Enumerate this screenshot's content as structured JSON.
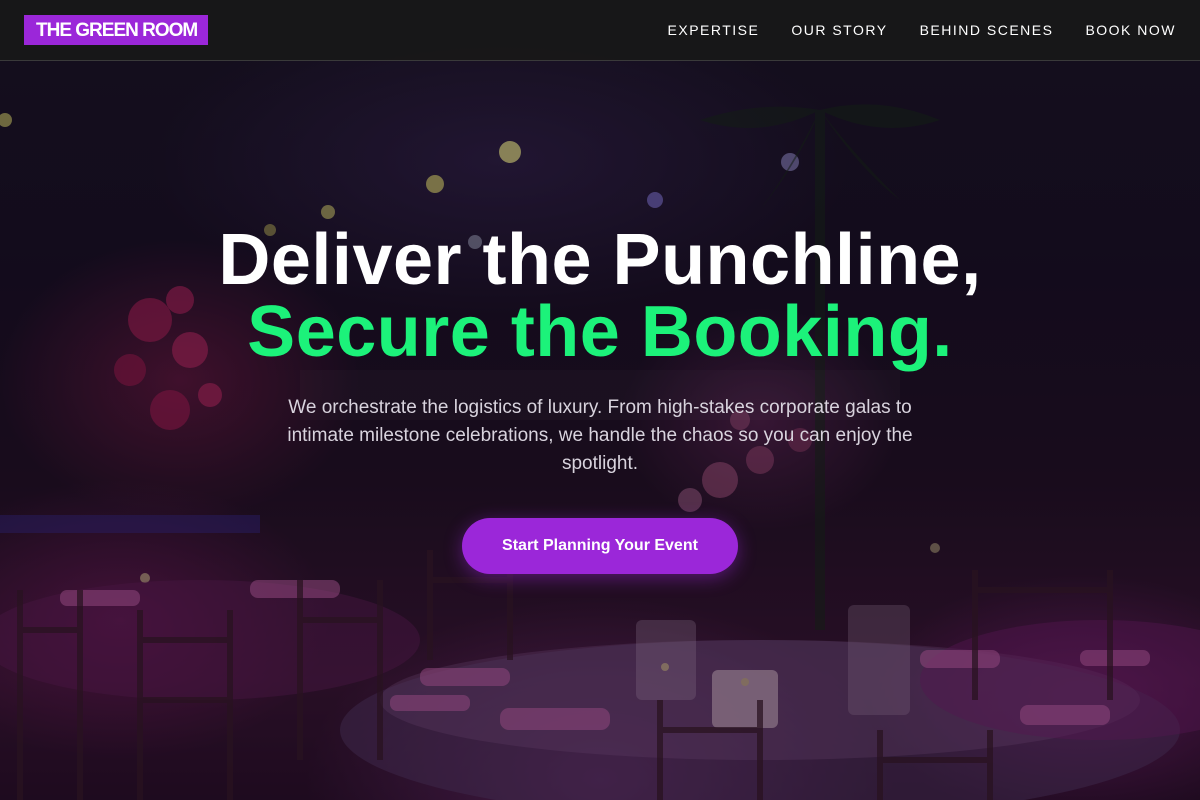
{
  "brand": {
    "logo_text": "THE GREEN ROOM",
    "accent_color": "#9b27d9",
    "highlight_color": "#1cf27a"
  },
  "nav": {
    "items": [
      {
        "label": "EXPERTISE"
      },
      {
        "label": "OUR STORY"
      },
      {
        "label": "BEHIND SCENES"
      },
      {
        "label": "BOOK NOW"
      }
    ]
  },
  "hero": {
    "headline_line1": "Deliver the Punchline,",
    "headline_line2": "Secure the Booking.",
    "subtitle": "We orchestrate the logistics of luxury. From high-stakes corporate galas to intimate milestone celebrations, we handle the chaos so you can enjoy the spotlight.",
    "cta_label": "Start Planning Your Event",
    "background": "event-banquet-photo"
  }
}
